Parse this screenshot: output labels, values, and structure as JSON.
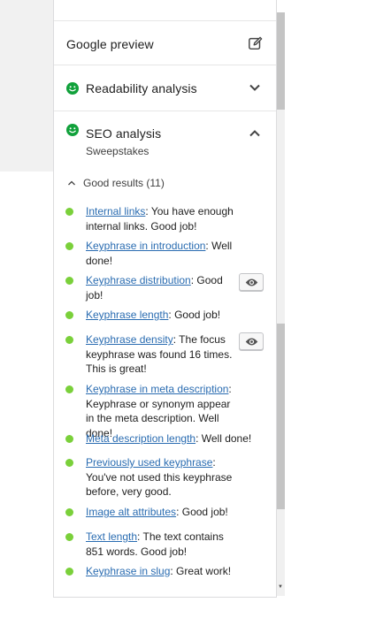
{
  "sections": {
    "google_preview": {
      "label": "Google preview",
      "icon": "edit-icon"
    },
    "readability": {
      "label": "Readability analysis",
      "icon": "chevron-down-icon",
      "status_icon": "smiley-good-icon"
    },
    "seo": {
      "label": "SEO analysis",
      "keyphrase": "Sweepstakes",
      "icon": "chevron-up-icon",
      "status_icon": "smiley-good-icon"
    }
  },
  "results": {
    "toggle_label": "Good results (11)",
    "status_color": "#7ad03a",
    "items": [
      {
        "link": "Internal links",
        "text": ": You have enough internal links. Good job!"
      },
      {
        "link": "Keyphrase in introduction",
        "text": ": Well done!"
      },
      {
        "link": "Keyphrase distribution",
        "text": ": Good job!",
        "has_eye": true
      },
      {
        "link": "Keyphrase length",
        "text": ": Good job!"
      },
      {
        "link": "Keyphrase density",
        "text": ": The focus keyphrase was found 16 times. This is great!",
        "has_eye": true
      },
      {
        "link": "Keyphrase in meta description",
        "text": ": Keyphrase or synonym appear in the meta description. Well done!"
      },
      {
        "link": "Meta description length",
        "text": ": Well done!"
      },
      {
        "link": "Previously used keyphrase",
        "text": ": You've not used this keyphrase before, very good."
      },
      {
        "link": "Image alt attributes",
        "text": ": Good job!"
      },
      {
        "link": "Text length",
        "text": ": The text contains 851 words. Good job!"
      },
      {
        "link": "Keyphrase in slug",
        "text": ": Great work!"
      }
    ]
  },
  "colors": {
    "link": "#2a6cb1",
    "good": "#7ad03a",
    "smiley": "#11a13b"
  }
}
